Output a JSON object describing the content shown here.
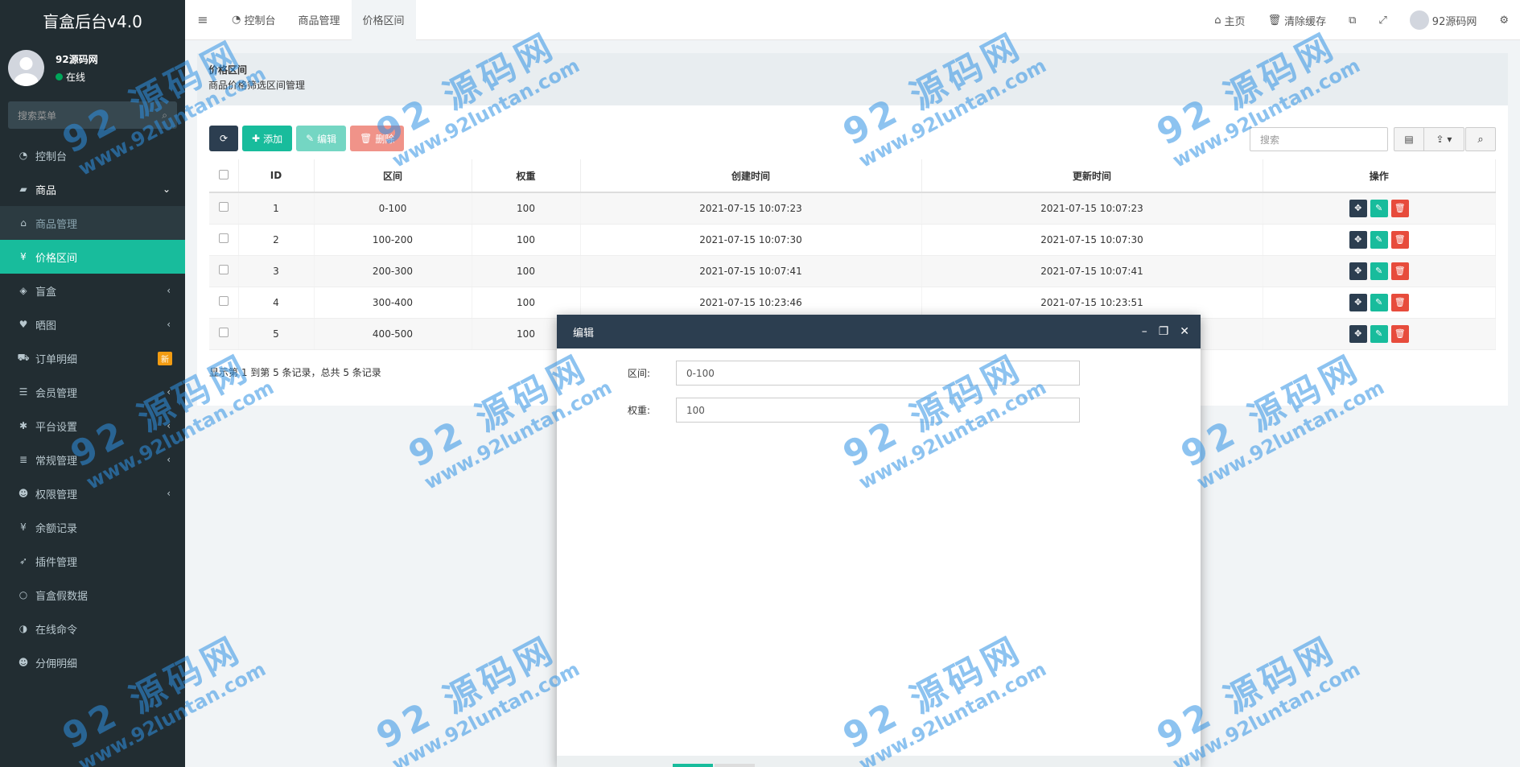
{
  "app": {
    "title": "盲盒后台v4.0"
  },
  "user": {
    "name": "92源码网",
    "status": "在线"
  },
  "sidebar": {
    "search_placeholder": "搜索菜单",
    "items": [
      {
        "label": "控制台",
        "icon": "dashboard-icon"
      },
      {
        "label": "商品",
        "icon": "bag-icon",
        "arrow": "⌄"
      },
      {
        "label": "商品管理",
        "icon": "shop-icon"
      },
      {
        "label": "价格区间",
        "icon": "yen-icon"
      },
      {
        "label": "盲盒",
        "icon": "cube-icon",
        "arrow": "‹"
      },
      {
        "label": "晒图",
        "icon": "heart-icon",
        "arrow": "‹"
      },
      {
        "label": "订单明细",
        "icon": "cart-icon",
        "badge": "新"
      },
      {
        "label": "会员管理",
        "icon": "list-icon",
        "arrow": "‹"
      },
      {
        "label": "平台设置",
        "icon": "gear-icon",
        "arrow": "‹"
      },
      {
        "label": "常规管理",
        "icon": "database-icon",
        "arrow": "‹"
      },
      {
        "label": "权限管理",
        "icon": "users-icon",
        "arrow": "‹"
      },
      {
        "label": "余额记录",
        "icon": "yen-icon"
      },
      {
        "label": "插件管理",
        "icon": "rocket-icon"
      },
      {
        "label": "盲盒假数据",
        "icon": "circle-icon"
      },
      {
        "label": "在线命令",
        "icon": "half-circle-icon"
      },
      {
        "label": "分佣明细",
        "icon": "users-icon"
      }
    ]
  },
  "topnav": {
    "tabs": [
      "控制台",
      "商品管理",
      "价格区间"
    ],
    "home": "主页",
    "clear_cache": "清除缓存",
    "user": "92源码网"
  },
  "page": {
    "title": "价格区间",
    "subtitle": "商品价格筛选区间管理"
  },
  "toolbar": {
    "add": "添加",
    "edit": "编辑",
    "delete": "删除",
    "search_placeholder": "搜索"
  },
  "table": {
    "headers": [
      "ID",
      "区间",
      "权重",
      "创建时间",
      "更新时间",
      "操作"
    ],
    "rows": [
      [
        "1",
        "0-100",
        "100",
        "2021-07-15 10:07:23",
        "2021-07-15 10:07:23"
      ],
      [
        "2",
        "100-200",
        "100",
        "2021-07-15 10:07:30",
        "2021-07-15 10:07:30"
      ],
      [
        "3",
        "200-300",
        "100",
        "2021-07-15 10:07:41",
        "2021-07-15 10:07:41"
      ],
      [
        "4",
        "300-400",
        "100",
        "2021-07-15 10:23:46",
        "2021-07-15 10:23:51"
      ],
      [
        "5",
        "400-500",
        "100",
        "",
        ""
      ]
    ],
    "pager": "显示第 1 到第 5 条记录，总共 5 条记录"
  },
  "modal": {
    "title": "编辑",
    "fields": [
      {
        "label": "区间:",
        "value": "0-100"
      },
      {
        "label": "权重:",
        "value": "100"
      }
    ]
  },
  "watermark": {
    "line1": "92 源码网",
    "line2": "www.92luntan.com"
  },
  "colors": {
    "sidebar": "#222d32",
    "accent": "#18bc9c",
    "danger": "#e74c3c",
    "dark": "#2c3e50",
    "warning": "#f39c12"
  }
}
